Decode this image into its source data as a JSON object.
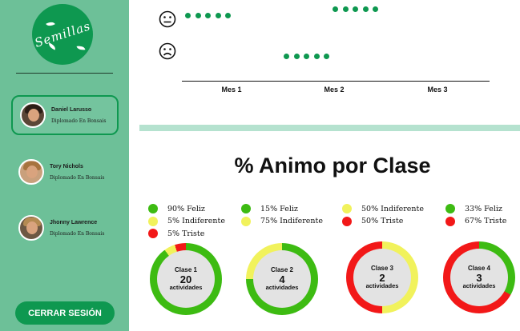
{
  "app": {
    "logo_text": "Semillas"
  },
  "sidebar": {
    "users": [
      {
        "name": "Daniel Larusso",
        "course": "Diplomado En Bonsais",
        "active": true
      },
      {
        "name": "Tory Nichols",
        "course": "Diplomado En Bonsais",
        "active": false
      },
      {
        "name": "Jhonny Lawrence",
        "course": "Diplomado En Bonsais",
        "active": false
      }
    ],
    "logout_label": "CERRAR SESIÓN"
  },
  "colors": {
    "primary": "#0e9850",
    "sidebar_bg": "#6dc098",
    "feliz": "#3dbb12",
    "indiferente": "#f1f25c",
    "triste": "#f21818",
    "donut_center": "#e3e3e3"
  },
  "mood_chart": {
    "icons": [
      "neutral-face-icon",
      "sad-face-icon"
    ],
    "months": [
      "Mes 1",
      "Mes 2",
      "Mes 3"
    ],
    "rows": [
      {
        "mood": "Indiferente",
        "dot_counts": [
          5,
          0,
          0
        ]
      },
      {
        "mood": "Triste",
        "dot_counts": [
          0,
          5,
          0
        ]
      }
    ],
    "top_row_dot_counts": [
      0,
      5,
      0
    ]
  },
  "section_title": "% Animo por Clase",
  "classes": [
    {
      "label": "Clase 1",
      "count": "20",
      "unit": "actividades",
      "legend": [
        {
          "mood": "feliz",
          "text": "90% Feliz"
        },
        {
          "mood": "indiferente",
          "text": "5% Indiferente"
        },
        {
          "mood": "triste",
          "text": "5% Triste"
        }
      ],
      "shares": {
        "feliz": 90,
        "indiferente": 5,
        "triste": 5
      }
    },
    {
      "label": "Clase 2",
      "count": "4",
      "unit": "actividades",
      "legend": [
        {
          "mood": "feliz",
          "text": "15% Feliz"
        },
        {
          "mood": "indiferente",
          "text": "75% Indiferente"
        }
      ],
      "shares": {
        "feliz": 75,
        "indiferente": 25,
        "triste": 0
      }
    },
    {
      "label": "Clase 3",
      "count": "2",
      "unit": "actividades",
      "legend": [
        {
          "mood": "indiferente",
          "text": "50% Indiferente"
        },
        {
          "mood": "triste",
          "text": "50% Triste"
        }
      ],
      "shares": {
        "feliz": 0,
        "indiferente": 50,
        "triste": 50
      }
    },
    {
      "label": "Clase 4",
      "count": "3",
      "unit": "actividades",
      "legend": [
        {
          "mood": "feliz",
          "text": "33% Feliz"
        },
        {
          "mood": "triste",
          "text": "67% Triste"
        }
      ],
      "shares": {
        "feliz": 33,
        "indiferente": 0,
        "triste": 67
      }
    }
  ]
}
